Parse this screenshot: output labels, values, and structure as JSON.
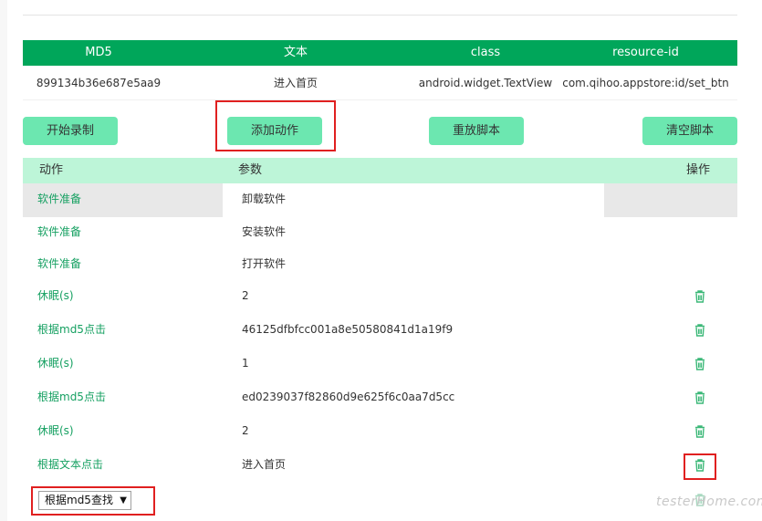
{
  "info_table": {
    "headers": [
      "MD5",
      "文本",
      "class",
      "resource-id"
    ],
    "row": [
      "899134b36e687e5aa9",
      "进入首页",
      "android.widget.TextView",
      "com.qihoo.appstore:id/set_btn"
    ]
  },
  "buttons": {
    "start_record": "开始录制",
    "add_action": "添加动作",
    "replay_script": "重放脚本",
    "clear_script": "清空脚本"
  },
  "action_table": {
    "headers": {
      "action": "动作",
      "params": "参数",
      "operation": "操作"
    },
    "rows": [
      {
        "action": "软件准备",
        "param": "卸载软件"
      },
      {
        "action": "软件准备",
        "param": "安装软件"
      },
      {
        "action": "软件准备",
        "param": "打开软件"
      },
      {
        "action": "休眠(s)",
        "param": "2"
      },
      {
        "action": "根据md5点击",
        "param": "46125dfbfcc001a8e50580841d1a19f9"
      },
      {
        "action": "休眠(s)",
        "param": "1"
      },
      {
        "action": "根据md5点击",
        "param": "ed0239037f82860d9e625f6c0aa7d5cc"
      },
      {
        "action": "休眠(s)",
        "param": "2"
      },
      {
        "action": "根据文本点击",
        "param": "进入首页"
      }
    ]
  },
  "select": {
    "value": "根据md5查找"
  },
  "watermark": "testerHome.com",
  "colors": {
    "header_green": "#00a65a",
    "button_green": "#6ce7b0",
    "action_text": "#15a061",
    "highlight_red": "#e02020"
  },
  "icons": {
    "delete": "trash-icon",
    "dropdown": "triangle-down"
  }
}
